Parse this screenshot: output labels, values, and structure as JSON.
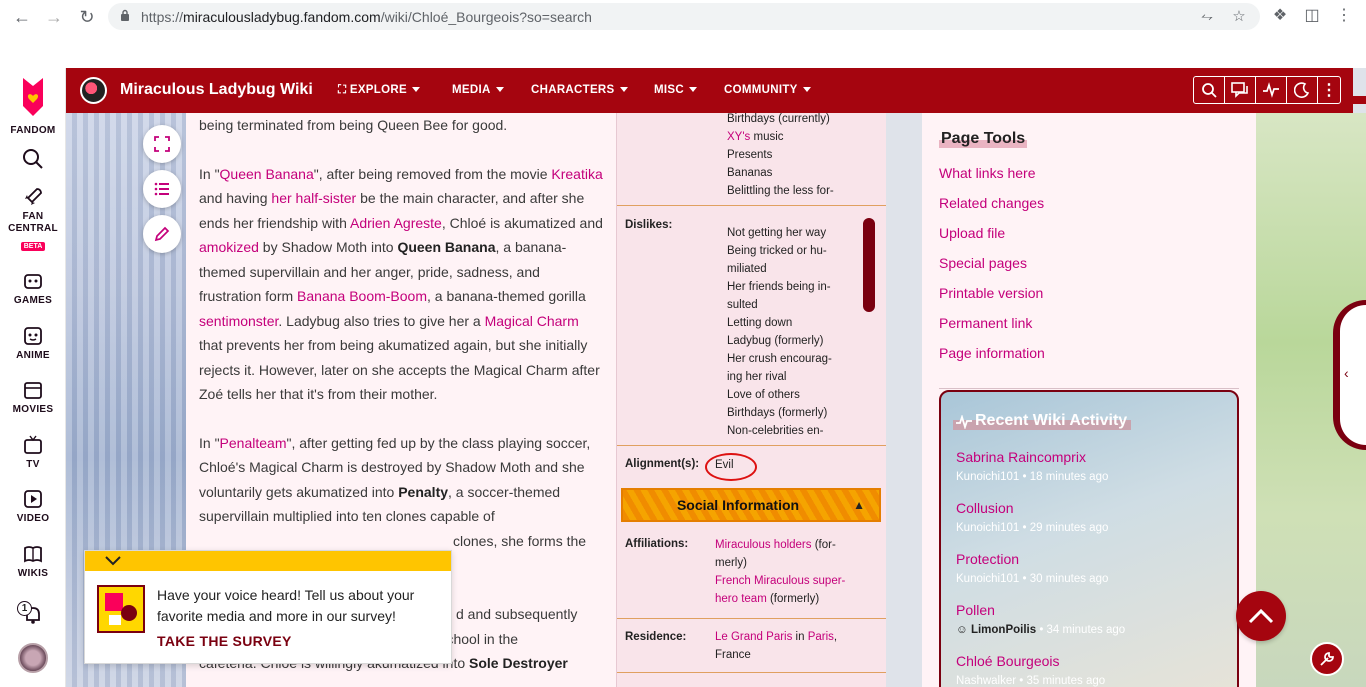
{
  "browser": {
    "url_prefix": "https://",
    "url_domain": "miraculousladybug.fandom.com",
    "url_path": "/wiki/Chloé_Bourgeois?so=search"
  },
  "rail": {
    "fandom": "FANDOM",
    "fan_central": "FAN CENTRAL",
    "beta": "BETA",
    "games": "GAMES",
    "anime": "ANIME",
    "movies": "MOVIES",
    "tv": "TV",
    "video": "VIDEO",
    "wikis": "WIKIS",
    "notification_count": "1"
  },
  "header": {
    "title": "Miraculous Ladybug Wiki",
    "nav": [
      "EXPLORE",
      "MEDIA",
      "CHARACTERS",
      "MISC",
      "COMMUNITY"
    ]
  },
  "article": {
    "p0": "being terminated from being Queen Bee for good.",
    "p1": {
      "t1": "In \"",
      "l1": "Queen Banana",
      "t2": "\", after being removed from the movie ",
      "l2": "Kreatika",
      "t3": " and having ",
      "l3": "her half-sister",
      "t4": " be the main character, and after she ends her friendship with ",
      "l4": "Adrien Agreste",
      "t5": ", Chloé is akumatized and ",
      "l5": "amokized",
      "t6": " by Shadow Moth into ",
      "b1": "Queen Banana",
      "t7": ", a banana-themed supervillain and her anger, pride, sadness, and frustration form ",
      "l6": "Banana Boom-Boom",
      "t8": ", a banana-themed gorilla ",
      "l7": "sentimonster",
      "t9": ". Ladybug also tries to give her a ",
      "l8": "Magical Charm",
      "t10": " that prevents her from being akumatized again, but she initially rejects it. However, later on she accepts the Magical Charm after Zoé tells her that it's from their mother."
    },
    "p2": {
      "t1": "In \"",
      "l1": "Penalteam",
      "t2": "\", after getting fed up by the class playing soccer, Chloé's Magical Charm is destroyed by Shadow Moth and she voluntarily gets akumatized into ",
      "b1": "Penalty",
      "t3": ", a soccer-themed supervillain multiplied into ten clones capable of",
      "t4": " clones, she forms the"
    },
    "p3": {
      "t1": "d and subsequently",
      "t2": "humiliated by Zoé in front of the whole school in the",
      "t3": "cafeteria. Chloé is willingly akumatized into ",
      "b1": "Sole Destroyer"
    }
  },
  "infobox": {
    "likes_list": [
      "Birthdays (currently)",
      "XY's",
      " music",
      "Presents",
      "Bananas",
      "Belittling the less for-"
    ],
    "dislikes_label": "Dislikes:",
    "dislikes": [
      "Not getting her way",
      "Being tricked or hu-",
      "miliated",
      "Her friends being in-",
      "sulted",
      "Letting down",
      "Ladybug (formerly)",
      "Her crush encourag-",
      "ing her rival",
      "Love of others",
      "Birthdays (formerly)",
      "Non-celebrities en-"
    ],
    "alignment_label": "Alignment(s):",
    "alignment_value": "Evil",
    "social_title": "Social Information",
    "affiliations_label": "Affiliations:",
    "aff_link1": "Miraculous holders",
    "aff_t1": " (for-",
    "aff_t2": "merly)",
    "aff_link2a": "French Miraculous super-",
    "aff_link2b": "hero team",
    "aff_t3": " (formerly)",
    "residence_label": "Residence:",
    "res_link1": "Le Grand Paris",
    "res_t1": " in ",
    "res_link2": "Paris",
    "res_t2": ",",
    "res_t3": "France"
  },
  "page_tools": {
    "title": "Page Tools",
    "links": [
      "What links here",
      "Related changes",
      "Upload file",
      "Special pages",
      "Printable version",
      "Permanent link",
      "Page information"
    ]
  },
  "activity": {
    "title": "Recent Wiki Activity",
    "items": [
      {
        "page": "Sabrina Raincomprix",
        "user": "Kunoichi101",
        "time": " • 18 minutes ago"
      },
      {
        "page": "Collusion",
        "user": "Kunoichi101",
        "time": " • 29 minutes ago"
      },
      {
        "page": "Protection",
        "user": "Kunoichi101",
        "time": " • 30 minutes ago"
      },
      {
        "page": "Pollen",
        "user": "LimonPoilis",
        "time": " • 34 minutes ago"
      },
      {
        "page": "Chloé Bourgeois",
        "user": "Nashwalker",
        "time": " • 35 minutes ago"
      }
    ]
  },
  "survey": {
    "text": "Have your voice heard! Tell us about your favorite media and more in our survey!",
    "cta": "TAKE THE SURVEY"
  },
  "colors": {
    "header_red": "#a5050f",
    "link_pink": "#c4007b",
    "survey_yellow": "#ffc500",
    "social_orange": "#f08c00"
  }
}
